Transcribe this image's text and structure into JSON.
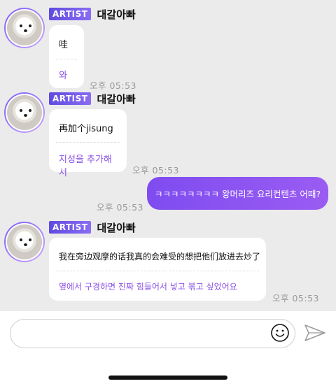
{
  "messages": [
    {
      "badge": "ARTIST",
      "name": "대갈아빠",
      "original": "哇",
      "translation": "와",
      "time": "오후 05:53"
    },
    {
      "badge": "ARTIST",
      "name": "대갈아빠",
      "original": "再加个jisung",
      "translation": "지성을 추가해서",
      "time": "오후 05:53"
    },
    {
      "badge": "ARTIST",
      "name": "대갈아빠",
      "original": "我在旁边观摩的话我真的会难受的想把他们放进去炒了",
      "translation": "옆에서 구경하면 진짜 힘들어서 넣고 볶고 싶었어요",
      "time": "오후 05:53"
    }
  ],
  "outgoing": {
    "text": "ㅋㅋㅋㅋㅋㅋㅋㅋ 왕머리즈 요리컨텐츠 어때?",
    "time": "오후 05:53"
  },
  "composer": {
    "placeholder": "",
    "emoji_icon": "smiley-icon",
    "send_icon": "send-icon"
  },
  "colors": {
    "accent": "#8a52e6",
    "badge": "#6a50e8",
    "background": "#ebebeb"
  }
}
